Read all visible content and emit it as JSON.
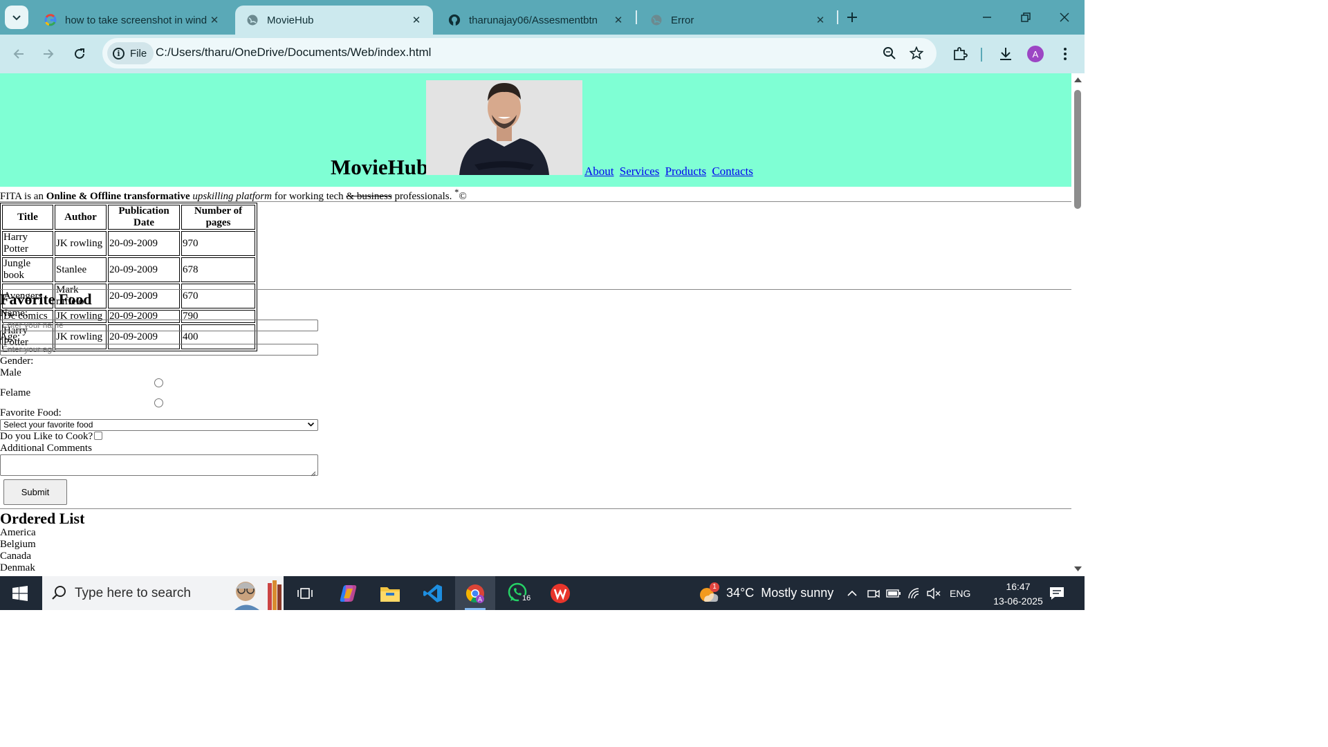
{
  "browser": {
    "tabs": [
      {
        "title": "how to take screenshot in wind",
        "favicon": "google-icon",
        "active": false
      },
      {
        "title": "MovieHub",
        "favicon": "globe-icon",
        "active": true
      },
      {
        "title": "tharunajay06/Assesmentbtn",
        "favicon": "github-icon",
        "active": false
      },
      {
        "title": "Error",
        "favicon": "globe-icon",
        "active": false
      }
    ],
    "address": {
      "chip_label": "File",
      "url": "C:/Users/tharu/OneDrive/Documents/Web/index.html"
    },
    "profile_initial": "A",
    "accent": "#5aa9b7"
  },
  "page": {
    "header": {
      "brand": "MovieHub",
      "nav": [
        "About",
        "Services",
        "Products",
        "Contacts"
      ],
      "background": "#7fffd4"
    },
    "intro": {
      "prefix": "FITA is an ",
      "bold": "Online & Offline transformative",
      "italic": "upskilling platform",
      "middle": " for working tech ",
      "strike": "& business",
      "suffix": " professionals. ",
      "sup": "*",
      "copyright": "©"
    },
    "table": {
      "headers": [
        "Title",
        "Author",
        "Publication Date",
        "Number of pages"
      ],
      "rows": [
        [
          "Harry Potter",
          "JK rowling",
          "20-09-2009",
          "970"
        ],
        [
          "Jungle book",
          "Stanlee",
          "20-09-2009",
          "678"
        ],
        [
          "Avengers",
          "Mark ruffelo",
          "20-09-2009",
          "670"
        ],
        [
          "Dc comics",
          "JK rowling",
          "20-09-2009",
          "790"
        ],
        [
          "Harry Potter",
          "JK rowling",
          "20-09-2009",
          "400"
        ]
      ]
    },
    "form": {
      "heading": "Favorite Food",
      "name_label": "Name:",
      "name_placeholder": "Enter your name",
      "age_label": "Age:",
      "age_placeholder": "Enter your age",
      "gender_label": "Gender:",
      "gender_options": [
        "Male",
        "Felame"
      ],
      "food_label": "Favorite Food:",
      "food_selected": "Select your favorite food",
      "cook_label": "Do you Like to Cook?",
      "comments_label": "Additional Comments",
      "submit_label": "Submit"
    },
    "ordered_list": {
      "heading": "Ordered List",
      "items": [
        "America",
        "Belgium",
        "Canada",
        "Denmak"
      ]
    }
  },
  "taskbar": {
    "search_placeholder": "Type here to search",
    "weather": {
      "temp": "34°C",
      "condition": "Mostly sunny",
      "alert": "1"
    },
    "whatsapp_badge": "16",
    "language": "ENG",
    "time": "16:47",
    "date": "13-06-2025"
  }
}
